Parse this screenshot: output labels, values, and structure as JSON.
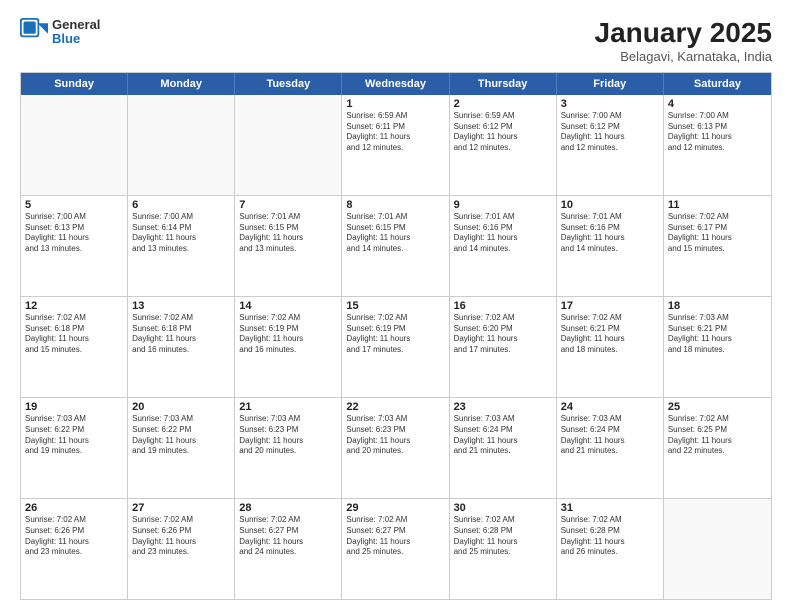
{
  "header": {
    "logo": {
      "general": "General",
      "blue": "Blue"
    },
    "title": "January 2025",
    "subtitle": "Belagavi, Karnataka, India"
  },
  "weekdays": [
    "Sunday",
    "Monday",
    "Tuesday",
    "Wednesday",
    "Thursday",
    "Friday",
    "Saturday"
  ],
  "rows": [
    [
      {
        "day": "",
        "text": "",
        "empty": true
      },
      {
        "day": "",
        "text": "",
        "empty": true
      },
      {
        "day": "",
        "text": "",
        "empty": true
      },
      {
        "day": "1",
        "text": "Sunrise: 6:59 AM\nSunset: 6:11 PM\nDaylight: 11 hours\nand 12 minutes."
      },
      {
        "day": "2",
        "text": "Sunrise: 6:59 AM\nSunset: 6:12 PM\nDaylight: 11 hours\nand 12 minutes."
      },
      {
        "day": "3",
        "text": "Sunrise: 7:00 AM\nSunset: 6:12 PM\nDaylight: 11 hours\nand 12 minutes."
      },
      {
        "day": "4",
        "text": "Sunrise: 7:00 AM\nSunset: 6:13 PM\nDaylight: 11 hours\nand 12 minutes."
      }
    ],
    [
      {
        "day": "5",
        "text": "Sunrise: 7:00 AM\nSunset: 6:13 PM\nDaylight: 11 hours\nand 13 minutes."
      },
      {
        "day": "6",
        "text": "Sunrise: 7:00 AM\nSunset: 6:14 PM\nDaylight: 11 hours\nand 13 minutes."
      },
      {
        "day": "7",
        "text": "Sunrise: 7:01 AM\nSunset: 6:15 PM\nDaylight: 11 hours\nand 13 minutes."
      },
      {
        "day": "8",
        "text": "Sunrise: 7:01 AM\nSunset: 6:15 PM\nDaylight: 11 hours\nand 14 minutes."
      },
      {
        "day": "9",
        "text": "Sunrise: 7:01 AM\nSunset: 6:16 PM\nDaylight: 11 hours\nand 14 minutes."
      },
      {
        "day": "10",
        "text": "Sunrise: 7:01 AM\nSunset: 6:16 PM\nDaylight: 11 hours\nand 14 minutes."
      },
      {
        "day": "11",
        "text": "Sunrise: 7:02 AM\nSunset: 6:17 PM\nDaylight: 11 hours\nand 15 minutes."
      }
    ],
    [
      {
        "day": "12",
        "text": "Sunrise: 7:02 AM\nSunset: 6:18 PM\nDaylight: 11 hours\nand 15 minutes."
      },
      {
        "day": "13",
        "text": "Sunrise: 7:02 AM\nSunset: 6:18 PM\nDaylight: 11 hours\nand 16 minutes."
      },
      {
        "day": "14",
        "text": "Sunrise: 7:02 AM\nSunset: 6:19 PM\nDaylight: 11 hours\nand 16 minutes."
      },
      {
        "day": "15",
        "text": "Sunrise: 7:02 AM\nSunset: 6:19 PM\nDaylight: 11 hours\nand 17 minutes."
      },
      {
        "day": "16",
        "text": "Sunrise: 7:02 AM\nSunset: 6:20 PM\nDaylight: 11 hours\nand 17 minutes."
      },
      {
        "day": "17",
        "text": "Sunrise: 7:02 AM\nSunset: 6:21 PM\nDaylight: 11 hours\nand 18 minutes."
      },
      {
        "day": "18",
        "text": "Sunrise: 7:03 AM\nSunset: 6:21 PM\nDaylight: 11 hours\nand 18 minutes."
      }
    ],
    [
      {
        "day": "19",
        "text": "Sunrise: 7:03 AM\nSunset: 6:22 PM\nDaylight: 11 hours\nand 19 minutes."
      },
      {
        "day": "20",
        "text": "Sunrise: 7:03 AM\nSunset: 6:22 PM\nDaylight: 11 hours\nand 19 minutes."
      },
      {
        "day": "21",
        "text": "Sunrise: 7:03 AM\nSunset: 6:23 PM\nDaylight: 11 hours\nand 20 minutes."
      },
      {
        "day": "22",
        "text": "Sunrise: 7:03 AM\nSunset: 6:23 PM\nDaylight: 11 hours\nand 20 minutes."
      },
      {
        "day": "23",
        "text": "Sunrise: 7:03 AM\nSunset: 6:24 PM\nDaylight: 11 hours\nand 21 minutes."
      },
      {
        "day": "24",
        "text": "Sunrise: 7:03 AM\nSunset: 6:24 PM\nDaylight: 11 hours\nand 21 minutes."
      },
      {
        "day": "25",
        "text": "Sunrise: 7:02 AM\nSunset: 6:25 PM\nDaylight: 11 hours\nand 22 minutes."
      }
    ],
    [
      {
        "day": "26",
        "text": "Sunrise: 7:02 AM\nSunset: 6:26 PM\nDaylight: 11 hours\nand 23 minutes."
      },
      {
        "day": "27",
        "text": "Sunrise: 7:02 AM\nSunset: 6:26 PM\nDaylight: 11 hours\nand 23 minutes."
      },
      {
        "day": "28",
        "text": "Sunrise: 7:02 AM\nSunset: 6:27 PM\nDaylight: 11 hours\nand 24 minutes."
      },
      {
        "day": "29",
        "text": "Sunrise: 7:02 AM\nSunset: 6:27 PM\nDaylight: 11 hours\nand 25 minutes."
      },
      {
        "day": "30",
        "text": "Sunrise: 7:02 AM\nSunset: 6:28 PM\nDaylight: 11 hours\nand 25 minutes."
      },
      {
        "day": "31",
        "text": "Sunrise: 7:02 AM\nSunset: 6:28 PM\nDaylight: 11 hours\nand 26 minutes."
      },
      {
        "day": "",
        "text": "",
        "empty": true
      }
    ]
  ]
}
